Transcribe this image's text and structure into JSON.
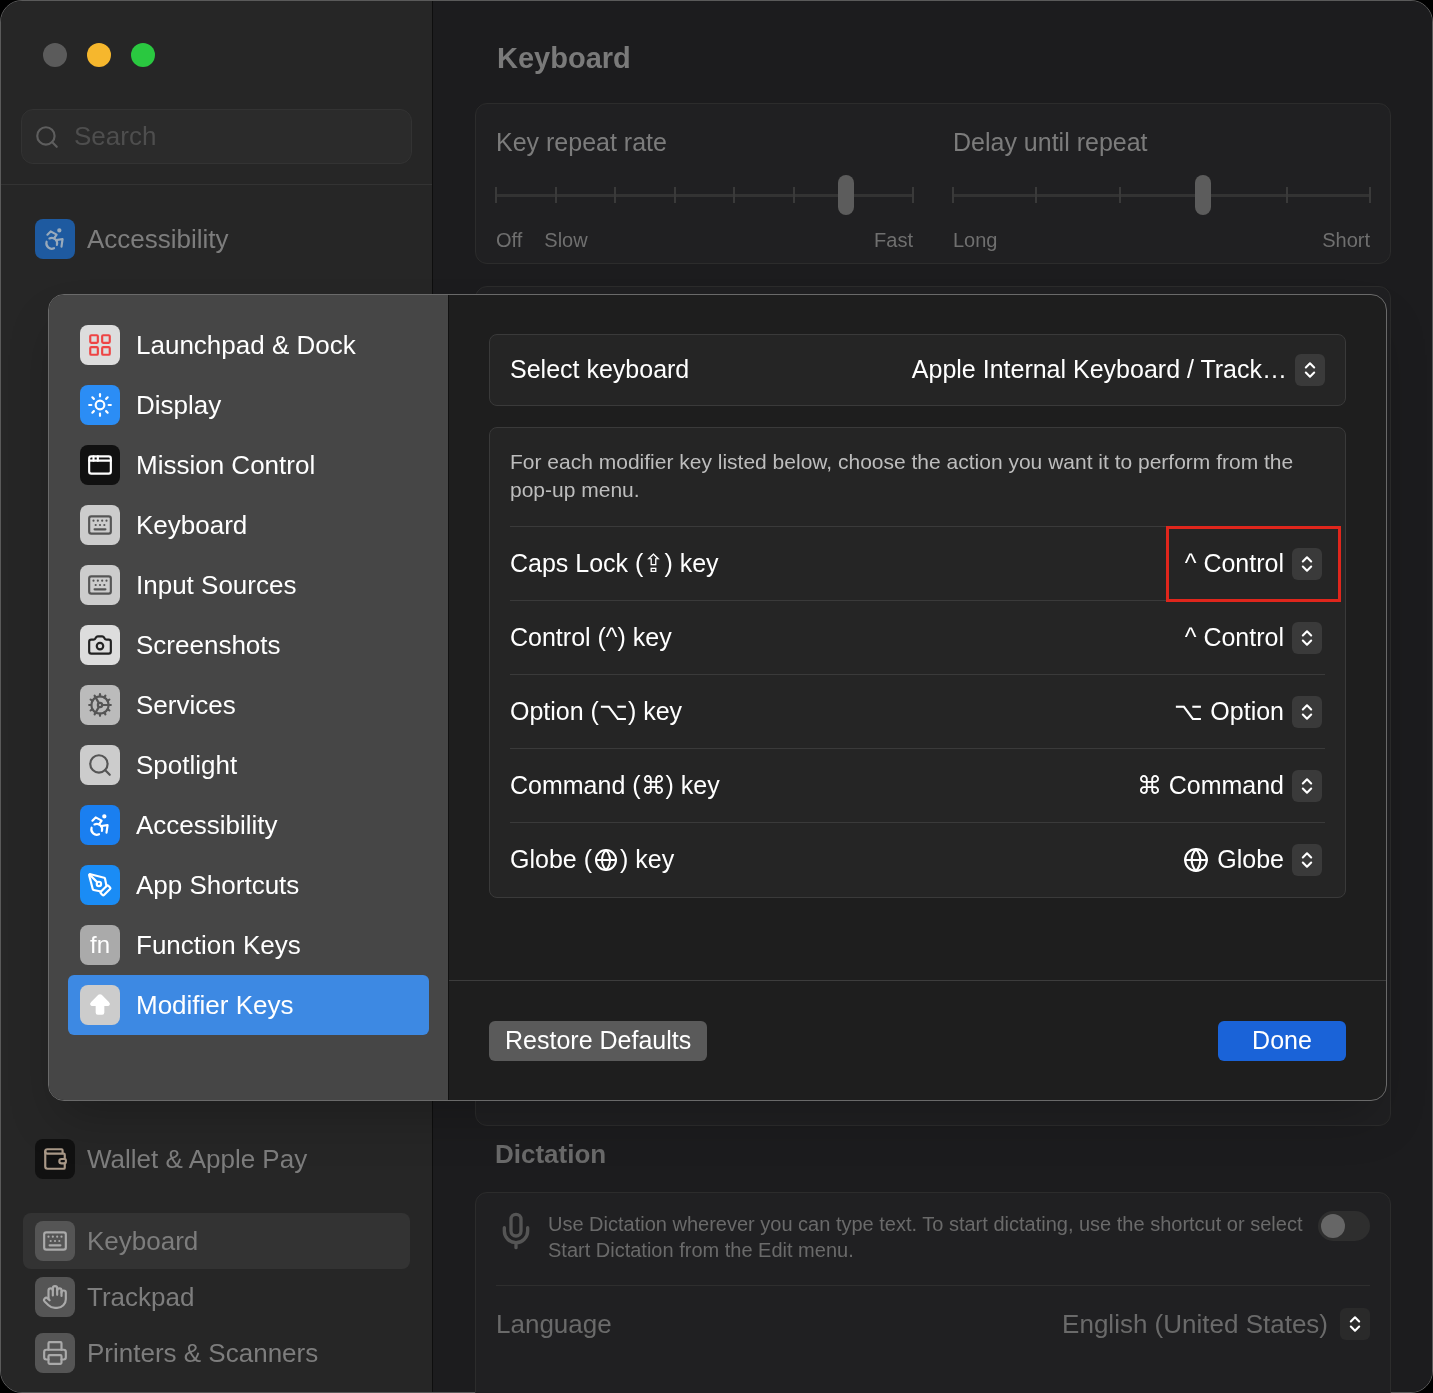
{
  "window": {
    "traffic_lights": [
      {
        "color": "#5b5b5b"
      },
      {
        "color": "#f6b72d"
      },
      {
        "color": "#2ac840"
      }
    ]
  },
  "sidebar": {
    "search": {
      "placeholder": "Search"
    },
    "items": [
      {
        "label": "Accessibility",
        "selected": false
      },
      {
        "label": "Wallet & Apple Pay",
        "selected": false
      },
      {
        "label": "Keyboard",
        "selected": true
      },
      {
        "label": "Trackpad",
        "selected": false
      },
      {
        "label": "Printers & Scanners",
        "selected": false
      }
    ]
  },
  "main": {
    "title": "Keyboard",
    "sliders": [
      {
        "label": "Key repeat rate",
        "level": 0.84,
        "marks": [
          "Off",
          "Slow",
          "Fast"
        ]
      },
      {
        "label": "Delay until repeat",
        "level": 0.6,
        "marks": [
          "Long",
          "Short"
        ]
      }
    ],
    "dictation": {
      "heading": "Dictation",
      "text": "Use Dictation wherever you can type text. To start dictating, use the shortcut or select Start Dictation from the Edit menu.",
      "on": false,
      "language_label": "Language",
      "language": "English (United States)"
    }
  },
  "sheet": {
    "sidebar": [
      {
        "label": "Launchpad & Dock",
        "selected": false
      },
      {
        "label": "Display",
        "selected": false
      },
      {
        "label": "Mission Control",
        "selected": false
      },
      {
        "label": "Keyboard",
        "selected": false
      },
      {
        "label": "Input Sources",
        "selected": false
      },
      {
        "label": "Screenshots",
        "selected": false
      },
      {
        "label": "Services",
        "selected": false
      },
      {
        "label": "Spotlight",
        "selected": false
      },
      {
        "label": "Accessibility",
        "selected": false
      },
      {
        "label": "App Shortcuts",
        "selected": false
      },
      {
        "label": "Function Keys",
        "selected": false,
        "icon_text": "fn"
      },
      {
        "label": "Modifier Keys",
        "selected": true
      }
    ],
    "select_keyboard": {
      "label": "Select keyboard",
      "value": "Apple Internal Keyboard / Track…"
    },
    "description": "For each modifier key listed below, choose the action you want it to perform from the pop-up menu.",
    "rows": [
      {
        "kind": "text",
        "label": "Caps Lock (⇪) key",
        "value": "^ Control",
        "highlighted": true
      },
      {
        "kind": "text",
        "label": "Control (^) key",
        "value": "^ Control",
        "highlighted": false
      },
      {
        "kind": "text",
        "label": "Option (⌥) key",
        "value": "⌥ Option",
        "highlighted": false
      },
      {
        "kind": "text",
        "label": "Command (⌘) key",
        "value": "⌘ Command",
        "highlighted": false
      },
      {
        "kind": "globe",
        "label_parts": [
          "Globe (",
          ") key"
        ],
        "value": "Globe",
        "highlighted": false
      }
    ],
    "buttons": {
      "restore": "Restore Defaults",
      "done": "Done"
    }
  }
}
